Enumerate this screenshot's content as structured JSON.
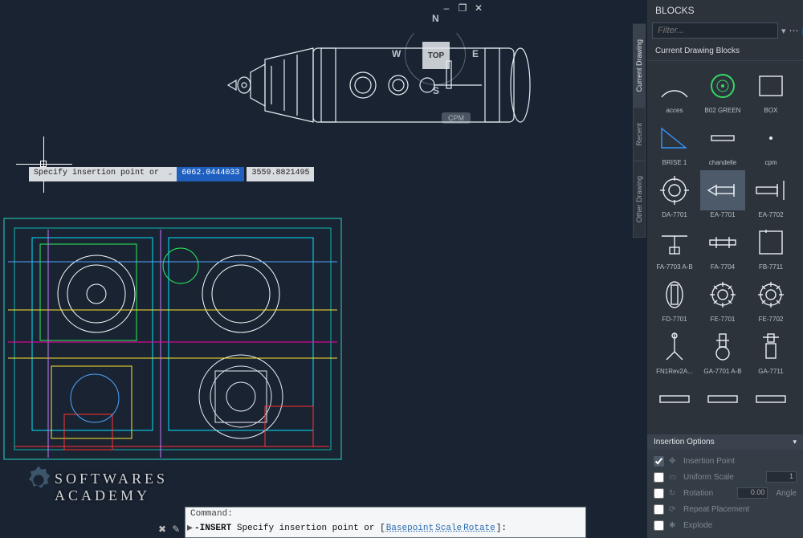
{
  "titlebar": {
    "minimize": "–",
    "restore": "❐",
    "close": "✕"
  },
  "viewcube": {
    "top": "TOP",
    "n": "N",
    "s": "S",
    "e": "E",
    "w": "W"
  },
  "wcs_btn": "CPM",
  "dyninput": {
    "prompt": "Specify insertion point or",
    "coordA": "6062.0444033",
    "coordB": "3559.8821495"
  },
  "watermark": {
    "line1": "SOFTWARES",
    "line2": "ACADEMY"
  },
  "cmdline": {
    "legend": "Command:",
    "arrow": "▸",
    "cmd": "-INSERT",
    "rest": "Specify insertion point or [",
    "opt1": "Basepoint",
    "opt2": "Scale",
    "opt3": "Rotate",
    "tail": "]:"
  },
  "palette": {
    "title": "BLOCKS",
    "filter_placeholder": "Filter...",
    "section_title": "Current Drawing Blocks",
    "vtabs": [
      "Current Drawing",
      "Recent",
      "Other Drawing"
    ],
    "insertion_options": {
      "header": "Insertion Options",
      "rows": [
        {
          "label": "Insertion Point",
          "checked": true,
          "value": ""
        },
        {
          "label": "Uniform Scale",
          "checked": false,
          "value": "1"
        },
        {
          "label": "Rotation",
          "checked": false,
          "value": "0.00",
          "suffix": "Angle"
        },
        {
          "label": "Repeat Placement",
          "checked": false
        },
        {
          "label": "Explode",
          "checked": false
        }
      ]
    },
    "blocks": [
      [
        {
          "name": "acces",
          "icon": "arc"
        },
        {
          "name": "B02 GREEN",
          "icon": "target-green"
        },
        {
          "name": "BOX",
          "icon": "box"
        }
      ],
      [
        {
          "name": "BRISE 1",
          "icon": "tri-blue"
        },
        {
          "name": "chandelle",
          "icon": "ibar"
        },
        {
          "name": "cpm",
          "icon": "dot"
        }
      ],
      [
        {
          "name": "DA-7701",
          "icon": "gear-w"
        },
        {
          "name": "EA-7701",
          "icon": "exchanger",
          "sel": true
        },
        {
          "name": "EA-7702",
          "icon": "exchanger2"
        }
      ],
      [
        {
          "name": "FA-7703 A-B",
          "icon": "tee"
        },
        {
          "name": "FA-7704",
          "icon": "hbar2"
        },
        {
          "name": "FB-7711",
          "icon": "rect-lg"
        }
      ],
      [
        {
          "name": "FD-7701",
          "icon": "oval-slot"
        },
        {
          "name": "FE-7701",
          "icon": "gear2"
        },
        {
          "name": "FE-7702",
          "icon": "gear2"
        }
      ],
      [
        {
          "name": "FN1Rev2A...",
          "icon": "stand"
        },
        {
          "name": "GA-7701 A-B",
          "icon": "pump-v"
        },
        {
          "name": "GA-7711",
          "icon": "pump-v2"
        }
      ],
      [
        {
          "name": "",
          "icon": "hbar-w"
        },
        {
          "name": "",
          "icon": "hbar-w"
        },
        {
          "name": "",
          "icon": "hbar-w"
        }
      ]
    ]
  }
}
